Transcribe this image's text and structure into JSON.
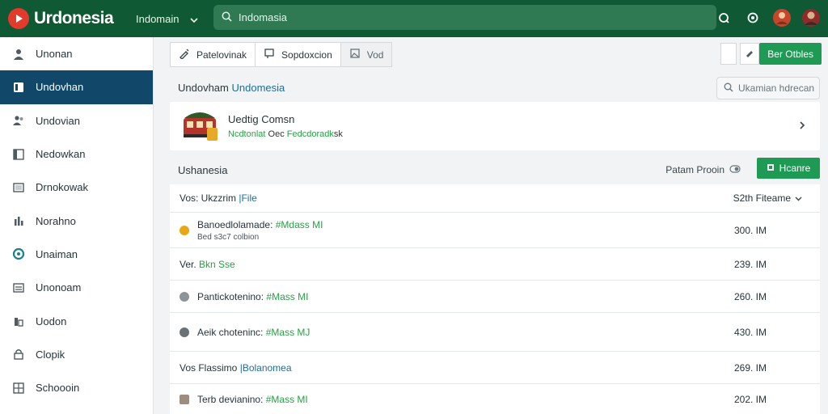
{
  "brand": {
    "name": "Urdonesia",
    "logo_color": "#e23a2b"
  },
  "workspace": {
    "label": "Indomain"
  },
  "search": {
    "placeholder": "Indomasia"
  },
  "sidebar": {
    "items": [
      {
        "label": "Unonan",
        "icon": "user-icon"
      },
      {
        "label": "Undovhan",
        "icon": "folder-icon",
        "active": true
      },
      {
        "label": "Undovian",
        "icon": "people-icon"
      },
      {
        "label": "Nedowkan",
        "icon": "window-icon"
      },
      {
        "label": "Drnokowak",
        "icon": "panel-icon"
      },
      {
        "label": "Norahno",
        "icon": "chart-icon"
      },
      {
        "label": "Unaiman",
        "icon": "target-icon"
      },
      {
        "label": "Unonoam",
        "icon": "list-icon"
      },
      {
        "label": "Uodon",
        "icon": "building-icon"
      },
      {
        "label": "Clopik",
        "icon": "lock-icon"
      },
      {
        "label": "Schoooin",
        "icon": "grid-icon"
      }
    ]
  },
  "toolbar": {
    "btn1": "Patelovinak",
    "btn2": "Sopdoxcion",
    "btn3": "Vod",
    "primary": "Ber Otbles"
  },
  "section": {
    "title_prefix": "Undovham",
    "title_accent": "Undomesia"
  },
  "filter": {
    "placeholder": "Ukamian hdrecan"
  },
  "card": {
    "title": "Uedtig Comsn",
    "sub_green1": "Ncdtonlat",
    "sub_mid": "Oec",
    "sub_green2": "Fedcdoradk",
    "sub_end": "sk"
  },
  "group": {
    "title": "Ushanesia",
    "rate": "Patam Prooin",
    "button": "Hcanre"
  },
  "list": {
    "header": {
      "prefix": "Vos: Ukzzrim",
      "accent": "|File",
      "right": "S2th Fiteame"
    },
    "rows": [
      {
        "left": "Banoedlolamade:",
        "green": "#Mdass MI",
        "sub": "Bed s3c7 colbion",
        "right": "300. IM",
        "icon_color": "#e8a815"
      },
      {
        "left": "Ver.",
        "green": "Bkn Sse",
        "right": "239. IM",
        "icon_color": ""
      },
      {
        "left": "Pantickotenino:",
        "green": "#Mass MI",
        "right": "260. IM",
        "icon_color": "#8d9398"
      },
      {
        "left": "Aeik choteninc:",
        "green": "#Mass MJ",
        "right": "430. IM",
        "icon_color": "#6b7277"
      },
      {
        "left": "Vos Flassimo",
        "accent": "|Bolanomea",
        "right": "269. IM",
        "icon_color": ""
      },
      {
        "left": "Terb devianino:",
        "green": "#Mass MI",
        "right": "202. IM",
        "icon_color": "#9e8d7c"
      }
    ]
  },
  "colors": {
    "topbar": "#0f5a34",
    "active_sidebar": "#11486a",
    "green": "#1f9a55"
  }
}
